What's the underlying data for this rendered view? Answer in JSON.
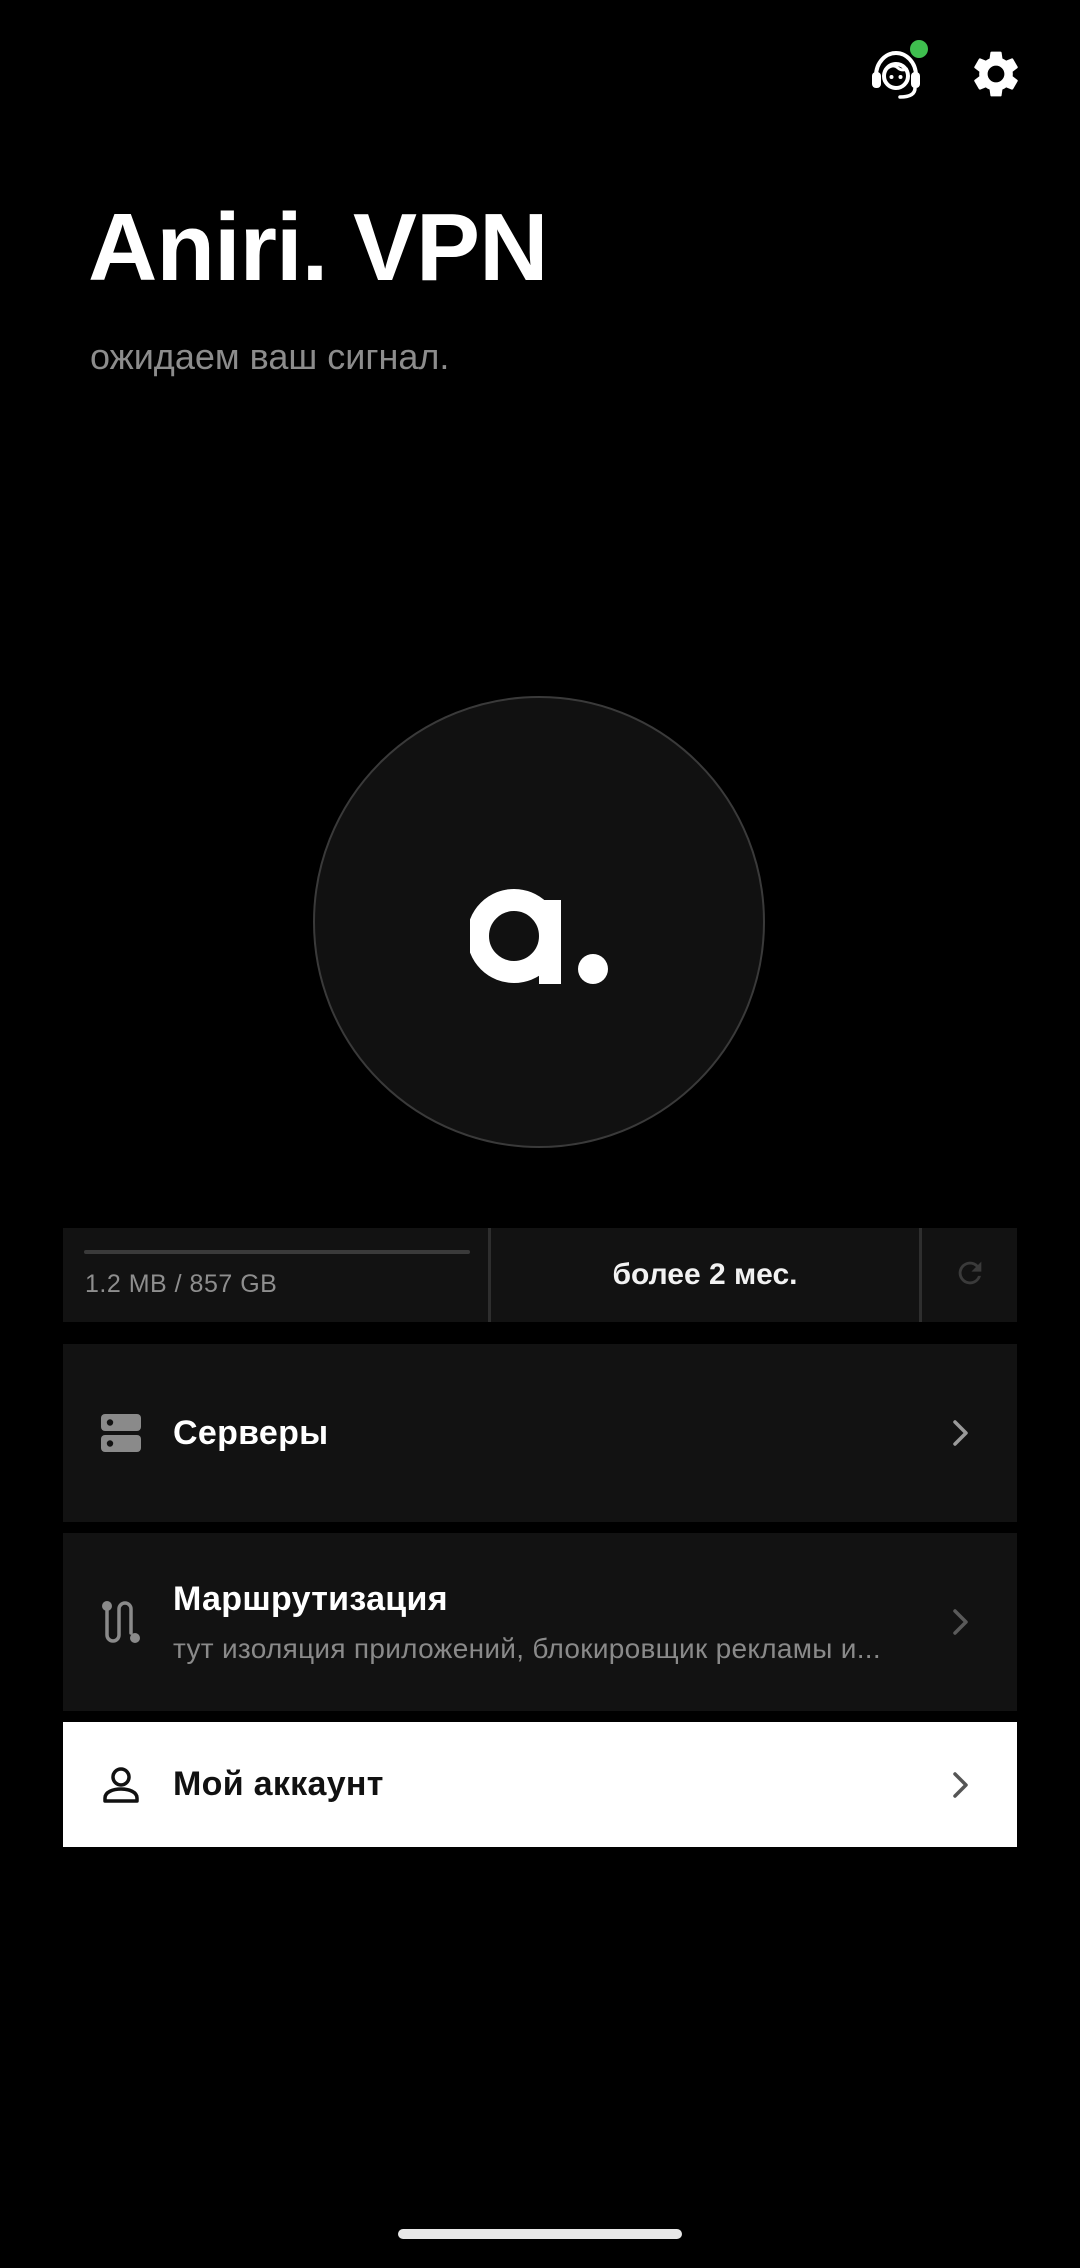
{
  "header": {
    "support_icon": "headset-support-icon",
    "support_status_color": "#3fbf4f",
    "settings_icon": "gear-icon"
  },
  "app": {
    "title": "Aniri. VPN",
    "subtitle": "ожидаем ваш сигнал."
  },
  "connect_button": {
    "logo_icon": "aniri-logo-icon"
  },
  "stats": {
    "traffic": "1.2 MB / 857 GB",
    "traffic_used_fraction": 0.0,
    "period": "более 2 мес.",
    "refresh_icon": "refresh-icon"
  },
  "menu": {
    "servers": {
      "icon": "server-icon",
      "title": "Серверы",
      "chevron": "chevron-right-icon"
    },
    "routing": {
      "icon": "route-icon",
      "title": "Маршрутизация",
      "description": "тут изоляция приложений, блокировщик рекламы и...",
      "chevron": "chevron-right-icon"
    },
    "account": {
      "icon": "user-icon",
      "title": "Мой аккаунт",
      "chevron": "chevron-right-icon"
    }
  },
  "colors": {
    "background": "#000000",
    "card_dark": "#121212",
    "card_light": "#ffffff",
    "accent_online": "#3fbf4f"
  }
}
